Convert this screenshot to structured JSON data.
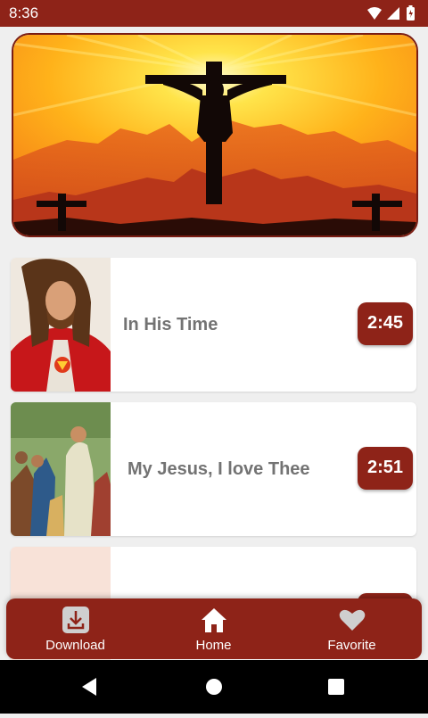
{
  "status_bar": {
    "time": "8:36"
  },
  "songs": [
    {
      "title": "In His Time",
      "duration": "2:45"
    },
    {
      "title": "My Jesus,  I love Thee",
      "duration": "2:51"
    },
    {
      "title": "",
      "duration": ""
    }
  ],
  "bottom_nav": {
    "download": "Download",
    "home": "Home",
    "favorite": "Favorite"
  },
  "colors": {
    "primary": "#8e2318",
    "title_text": "#737373"
  },
  "icons": [
    "wifi-icon",
    "signal-icon",
    "battery-icon",
    "download-icon",
    "home-icon",
    "heart-icon",
    "back-icon",
    "home-circle-icon",
    "recents-icon"
  ]
}
